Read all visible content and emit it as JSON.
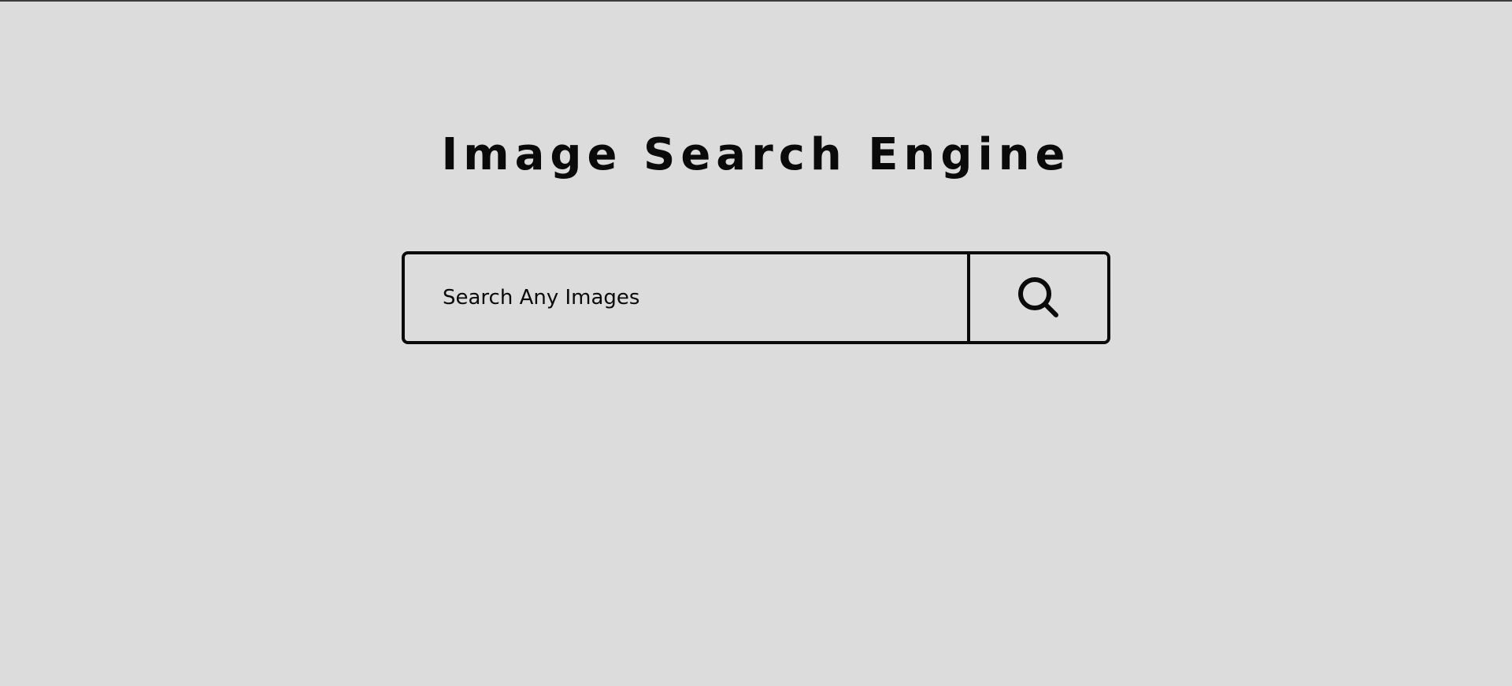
{
  "header": {
    "title": "Image Search Engine"
  },
  "search": {
    "placeholder": "Search Any Images",
    "value": "",
    "button_icon": "search-icon"
  },
  "colors": {
    "background": "#dcdcdc",
    "foreground": "#0a0a0a"
  }
}
